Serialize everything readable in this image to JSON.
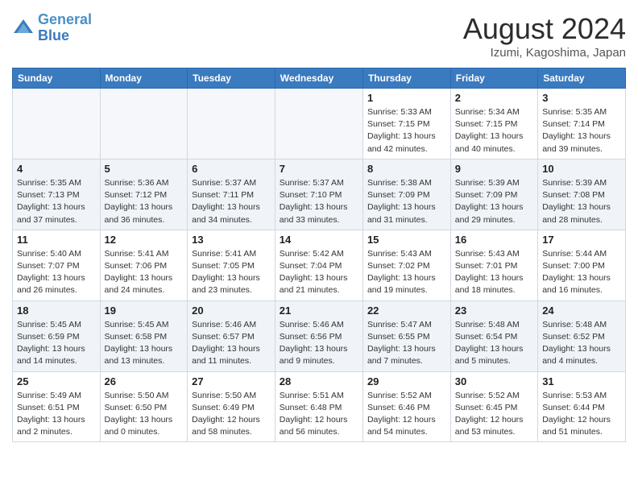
{
  "header": {
    "logo_line1": "General",
    "logo_line2": "Blue",
    "month_title": "August 2024",
    "location": "Izumi, Kagoshima, Japan"
  },
  "weekdays": [
    "Sunday",
    "Monday",
    "Tuesday",
    "Wednesday",
    "Thursday",
    "Friday",
    "Saturday"
  ],
  "weeks": [
    [
      {
        "day": "",
        "info": ""
      },
      {
        "day": "",
        "info": ""
      },
      {
        "day": "",
        "info": ""
      },
      {
        "day": "",
        "info": ""
      },
      {
        "day": "1",
        "info": "Sunrise: 5:33 AM\nSunset: 7:15 PM\nDaylight: 13 hours\nand 42 minutes."
      },
      {
        "day": "2",
        "info": "Sunrise: 5:34 AM\nSunset: 7:15 PM\nDaylight: 13 hours\nand 40 minutes."
      },
      {
        "day": "3",
        "info": "Sunrise: 5:35 AM\nSunset: 7:14 PM\nDaylight: 13 hours\nand 39 minutes."
      }
    ],
    [
      {
        "day": "4",
        "info": "Sunrise: 5:35 AM\nSunset: 7:13 PM\nDaylight: 13 hours\nand 37 minutes."
      },
      {
        "day": "5",
        "info": "Sunrise: 5:36 AM\nSunset: 7:12 PM\nDaylight: 13 hours\nand 36 minutes."
      },
      {
        "day": "6",
        "info": "Sunrise: 5:37 AM\nSunset: 7:11 PM\nDaylight: 13 hours\nand 34 minutes."
      },
      {
        "day": "7",
        "info": "Sunrise: 5:37 AM\nSunset: 7:10 PM\nDaylight: 13 hours\nand 33 minutes."
      },
      {
        "day": "8",
        "info": "Sunrise: 5:38 AM\nSunset: 7:09 PM\nDaylight: 13 hours\nand 31 minutes."
      },
      {
        "day": "9",
        "info": "Sunrise: 5:39 AM\nSunset: 7:09 PM\nDaylight: 13 hours\nand 29 minutes."
      },
      {
        "day": "10",
        "info": "Sunrise: 5:39 AM\nSunset: 7:08 PM\nDaylight: 13 hours\nand 28 minutes."
      }
    ],
    [
      {
        "day": "11",
        "info": "Sunrise: 5:40 AM\nSunset: 7:07 PM\nDaylight: 13 hours\nand 26 minutes."
      },
      {
        "day": "12",
        "info": "Sunrise: 5:41 AM\nSunset: 7:06 PM\nDaylight: 13 hours\nand 24 minutes."
      },
      {
        "day": "13",
        "info": "Sunrise: 5:41 AM\nSunset: 7:05 PM\nDaylight: 13 hours\nand 23 minutes."
      },
      {
        "day": "14",
        "info": "Sunrise: 5:42 AM\nSunset: 7:04 PM\nDaylight: 13 hours\nand 21 minutes."
      },
      {
        "day": "15",
        "info": "Sunrise: 5:43 AM\nSunset: 7:02 PM\nDaylight: 13 hours\nand 19 minutes."
      },
      {
        "day": "16",
        "info": "Sunrise: 5:43 AM\nSunset: 7:01 PM\nDaylight: 13 hours\nand 18 minutes."
      },
      {
        "day": "17",
        "info": "Sunrise: 5:44 AM\nSunset: 7:00 PM\nDaylight: 13 hours\nand 16 minutes."
      }
    ],
    [
      {
        "day": "18",
        "info": "Sunrise: 5:45 AM\nSunset: 6:59 PM\nDaylight: 13 hours\nand 14 minutes."
      },
      {
        "day": "19",
        "info": "Sunrise: 5:45 AM\nSunset: 6:58 PM\nDaylight: 13 hours\nand 13 minutes."
      },
      {
        "day": "20",
        "info": "Sunrise: 5:46 AM\nSunset: 6:57 PM\nDaylight: 13 hours\nand 11 minutes."
      },
      {
        "day": "21",
        "info": "Sunrise: 5:46 AM\nSunset: 6:56 PM\nDaylight: 13 hours\nand 9 minutes."
      },
      {
        "day": "22",
        "info": "Sunrise: 5:47 AM\nSunset: 6:55 PM\nDaylight: 13 hours\nand 7 minutes."
      },
      {
        "day": "23",
        "info": "Sunrise: 5:48 AM\nSunset: 6:54 PM\nDaylight: 13 hours\nand 5 minutes."
      },
      {
        "day": "24",
        "info": "Sunrise: 5:48 AM\nSunset: 6:52 PM\nDaylight: 13 hours\nand 4 minutes."
      }
    ],
    [
      {
        "day": "25",
        "info": "Sunrise: 5:49 AM\nSunset: 6:51 PM\nDaylight: 13 hours\nand 2 minutes."
      },
      {
        "day": "26",
        "info": "Sunrise: 5:50 AM\nSunset: 6:50 PM\nDaylight: 13 hours\nand 0 minutes."
      },
      {
        "day": "27",
        "info": "Sunrise: 5:50 AM\nSunset: 6:49 PM\nDaylight: 12 hours\nand 58 minutes."
      },
      {
        "day": "28",
        "info": "Sunrise: 5:51 AM\nSunset: 6:48 PM\nDaylight: 12 hours\nand 56 minutes."
      },
      {
        "day": "29",
        "info": "Sunrise: 5:52 AM\nSunset: 6:46 PM\nDaylight: 12 hours\nand 54 minutes."
      },
      {
        "day": "30",
        "info": "Sunrise: 5:52 AM\nSunset: 6:45 PM\nDaylight: 12 hours\nand 53 minutes."
      },
      {
        "day": "31",
        "info": "Sunrise: 5:53 AM\nSunset: 6:44 PM\nDaylight: 12 hours\nand 51 minutes."
      }
    ]
  ]
}
